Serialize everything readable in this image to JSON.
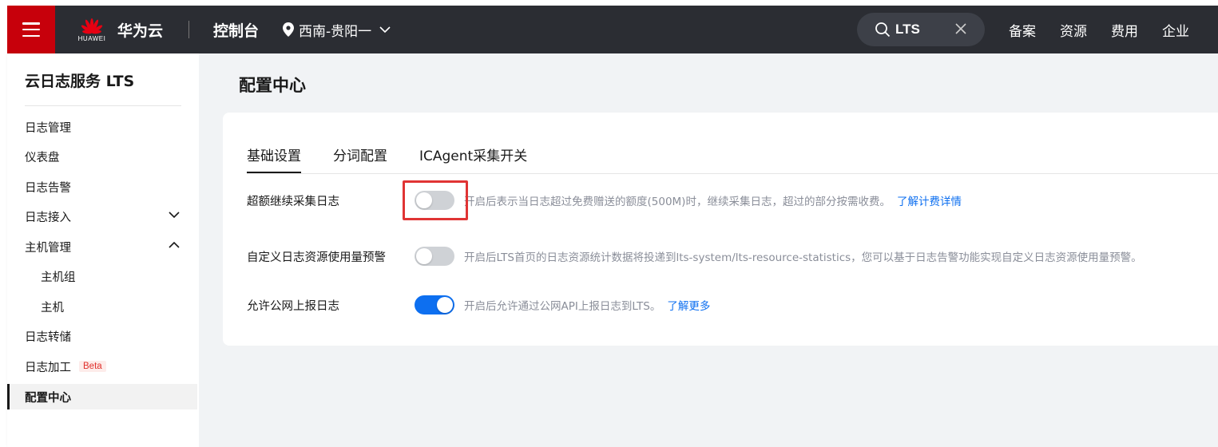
{
  "topbar": {
    "logo_text": "HUAWEI",
    "brand": "华为云",
    "console": "控制台",
    "region": "西南-贵阳一",
    "search_value": "LTS",
    "nav": [
      "备案",
      "资源",
      "费用",
      "企业"
    ]
  },
  "sidebar": {
    "title": "云日志服务 LTS",
    "items": [
      {
        "label": "日志管理"
      },
      {
        "label": "仪表盘"
      },
      {
        "label": "日志告警"
      },
      {
        "label": "日志接入"
      },
      {
        "label": "主机管理"
      },
      {
        "label": "主机组"
      },
      {
        "label": "主机"
      },
      {
        "label": "日志转储"
      },
      {
        "label": "日志加工",
        "badge": "Beta"
      },
      {
        "label": "配置中心"
      }
    ]
  },
  "main": {
    "page_title": "配置中心",
    "tabs": [
      "基础设置",
      "分词配置",
      "ICAgent采集开关"
    ],
    "settings": [
      {
        "label": "超额继续采集日志",
        "enabled": false,
        "desc": "开启后表示当日志超过免费赠送的额度(500M)时，继续采集日志，超过的部分按需收费。",
        "link": "了解计费详情"
      },
      {
        "label": "自定义日志资源使用量预警",
        "enabled": false,
        "desc": "开启后LTS首页的日志资源统计数据将投递到lts-system/lts-resource-statistics，您可以基于日志告警功能实现自定义日志资源使用量预警。",
        "link": ""
      },
      {
        "label": "允许公网上报日志",
        "enabled": true,
        "desc": "开启后允许通过公网API上报日志到LTS。",
        "link": "了解更多"
      }
    ]
  },
  "colors": {
    "topbar": "#2b2d33",
    "menu_accent": "#c7000b",
    "link": "#0d6ff0",
    "highlight": "#e03434"
  }
}
